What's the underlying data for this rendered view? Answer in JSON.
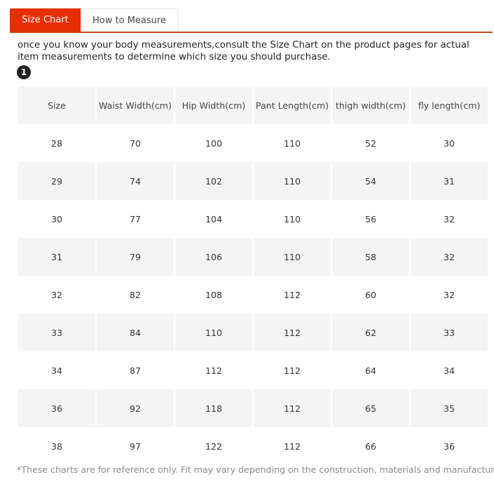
{
  "tabs": [
    {
      "label": "Size Chart",
      "active": true
    },
    {
      "label": "How to Measure",
      "active": false
    }
  ],
  "colors": {
    "accent": "#e62e04",
    "underline": "#c9471c",
    "row_gray": "#f4f4f4"
  },
  "intro_text": "once you know your body measurements,consult the Size Chart on the product pages for actual item measurements to determine which size you should purchase.",
  "badge": "1",
  "table": {
    "headers": [
      "Size",
      "Waist Width(cm)",
      "Hip Width(cm)",
      "Pant Length(cm)",
      "thigh width(cm)",
      "fly length(cm)"
    ],
    "rows": [
      [
        "28",
        "70",
        "100",
        "110",
        "52",
        "30"
      ],
      [
        "29",
        "74",
        "102",
        "110",
        "54",
        "31"
      ],
      [
        "30",
        "77",
        "104",
        "110",
        "56",
        "32"
      ],
      [
        "31",
        "79",
        "106",
        "110",
        "58",
        "32"
      ],
      [
        "32",
        "82",
        "108",
        "112",
        "60",
        "32"
      ],
      [
        "33",
        "84",
        "110",
        "112",
        "62",
        "33"
      ],
      [
        "34",
        "87",
        "112",
        "112",
        "64",
        "34"
      ],
      [
        "36",
        "92",
        "118",
        "112",
        "65",
        "35"
      ],
      [
        "38",
        "97",
        "122",
        "112",
        "66",
        "36"
      ]
    ]
  },
  "footer_note": "*These charts are for reference only. Fit may vary depending on the construction, materials and manufacturer."
}
